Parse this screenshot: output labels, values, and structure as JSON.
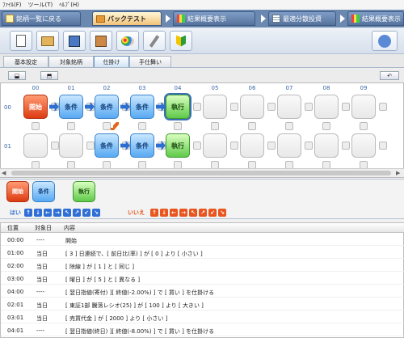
{
  "menubar": {
    "items": [
      "ﾌｧｲﾙ(F)",
      "ツール(T)",
      "ﾍﾙﾌﾟ(H)"
    ]
  },
  "navtabs": [
    {
      "label": "銘柄一覧に戻る",
      "active": false
    },
    {
      "label": "バックテスト",
      "active": true
    },
    {
      "label": "結果概要表示",
      "active": false
    },
    {
      "label": "最適分散投資",
      "active": false
    },
    {
      "label": "結果概要表示",
      "active": false
    }
  ],
  "subtabs": [
    {
      "label": "基本設定",
      "active": false
    },
    {
      "label": "対象銘柄",
      "active": false
    },
    {
      "label": "仕掛け",
      "active": true
    },
    {
      "label": "手仕舞い",
      "active": false
    }
  ],
  "grid": {
    "columns": [
      "00",
      "01",
      "02",
      "03",
      "04",
      "05",
      "06",
      "07",
      "08",
      "09"
    ],
    "rows": [
      "00",
      "01"
    ],
    "row00": [
      "開始",
      "条件",
      "条件",
      "条件",
      "執行"
    ],
    "row01": [
      "条件",
      "条件",
      "執行"
    ]
  },
  "palette": {
    "start": "開始",
    "cond": "条件",
    "exec": "執行",
    "yes_label": "はい",
    "no_label": "いいえ"
  },
  "table": {
    "headers": [
      "位置",
      "対象日",
      "内容"
    ],
    "rows": [
      [
        "00:00",
        "----",
        "開始"
      ],
      [
        "01:00",
        "当日",
        "[ 3 ] 日連続で、[ 前日比(率) ] が [ 0 ] より [ 小さい ]"
      ],
      [
        "02:00",
        "当日",
        "[ 除線 ] が [ 1 ] と [ 同じ ]"
      ],
      [
        "03:00",
        "当日",
        "[ 曜日 ] が [ 5 ] と [ 異なる ]"
      ],
      [
        "04:00",
        "----",
        "[ 翌日指値(寄付) ][ 終値(-2.00%) ] で [ 買い ] を仕掛ける"
      ],
      [
        "02:01",
        "当日",
        "[ 東証1部 騰落レシオ(25) ] が [ 100 ] より [ 大きい ]"
      ],
      [
        "03:01",
        "当日",
        "[ 売買代金 ] が [ 2000 ] より [ 小さい ]"
      ],
      [
        "04:01",
        "----",
        "[ 翌日指値(終日) ][ 終値(-8.00%) ] で [ 買い ] を仕掛ける"
      ]
    ]
  },
  "colors": {
    "accent": "#2c6fd1",
    "start": "#dd3b12",
    "cond": "#58a9f2",
    "exec": "#60c94a",
    "no": "#e8551f"
  }
}
